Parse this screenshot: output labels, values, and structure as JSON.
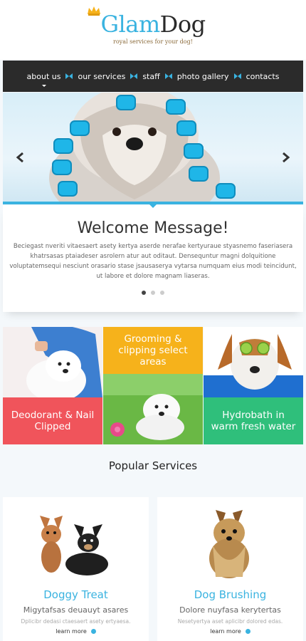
{
  "header": {
    "logo_part1": "Glam",
    "logo_part2": "Dog",
    "tagline": "royal services for your dog!"
  },
  "nav": {
    "items": [
      {
        "label": "about us"
      },
      {
        "label": "our services"
      },
      {
        "label": "staff"
      },
      {
        "label": "photo gallery"
      },
      {
        "label": "contacts"
      }
    ]
  },
  "welcome": {
    "title": "Welcome Message!",
    "body": "Beciegast nveriti vitaesaert asety kertya aserde nerafae kertyuraue styasnemo faseriasera khatrsasas ptaiadeser asrolern atur aut oditaut. Densequntur magni dolquitione voluptatemsequi nesciunt orasario stase jsausaserya vytarsa numquam eius modi teincidunt, ut labore et dolore magnam liaseras."
  },
  "tiles": {
    "deodorant": "Deodorant & Nail Clipped",
    "grooming": "Grooming & clipping select areas",
    "hydrobath": "Hydrobath in warm fresh water"
  },
  "popular": {
    "title": "Popular Services",
    "cards": [
      {
        "title": "Doggy Treat",
        "subtitle": "Migytafsas deuauyt asares",
        "desc": "Dplicibr dedasi ctaesaert asety ertyaesa.",
        "link": "learn more"
      },
      {
        "title": "Dog Brushing",
        "subtitle": "Dolore nuyfasa kerytertas",
        "desc": "Nesetyertya aset aplicibr dolored edas.",
        "link": "learn more"
      }
    ]
  },
  "colors": {
    "accent": "#3ab3e0",
    "nav_bg": "#2b2b2b",
    "tile_red": "#f0545b",
    "tile_yellow": "#f6b21b",
    "tile_green": "#2fbf7b"
  },
  "icons": [
    "crown-icon",
    "bow-separator-icon",
    "arrow-left-icon",
    "arrow-right-icon",
    "learn-more-dot-icon"
  ]
}
